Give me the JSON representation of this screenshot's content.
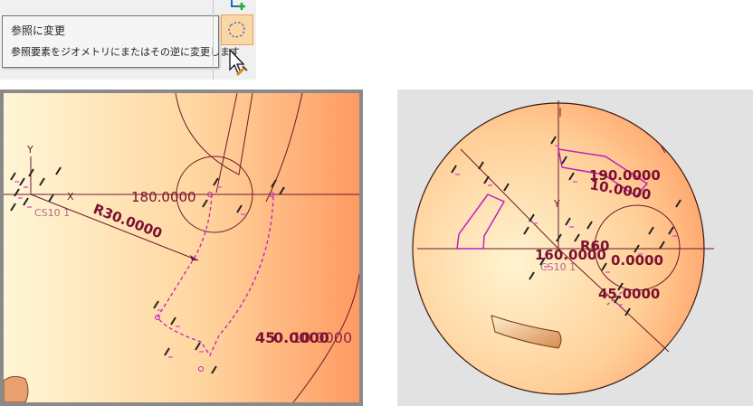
{
  "tooltip": {
    "title": "参照に変更",
    "description": "参照要素をジオメトリにまたはその逆に変更します"
  },
  "toolbar": {
    "buttons": [
      {
        "name": "sketch-plus-icon",
        "active": false
      },
      {
        "name": "convert-reference-icon",
        "active": true
      },
      {
        "name": "pick-tool-icon",
        "active": false
      }
    ]
  },
  "left_view": {
    "axis_y": "Y",
    "axis_x": "X",
    "csys_label": "CS10 1",
    "dim_angle": "180.0000",
    "dim_radius": "R30.0000",
    "dim_bottom_a": "45",
    "dim_bottom_b": "0.0000",
    "dim_bottom_c": "10.0000"
  },
  "right_view": {
    "dim_top": "190.0000",
    "dim_top_b": "10.0000",
    "dim_axis": "Y",
    "dim_mid_a": "160.0000",
    "dim_mid_b": "R60",
    "dim_mid_c": "0.0000",
    "csys_label": "CS10 1",
    "dim_bottom": "45.0000"
  },
  "colors": {
    "dimension": "#7a1030",
    "constraint": "#c020c0",
    "part_light": "#fff0c8",
    "part_dark": "#ffa870",
    "construction": "#b02ab0"
  }
}
